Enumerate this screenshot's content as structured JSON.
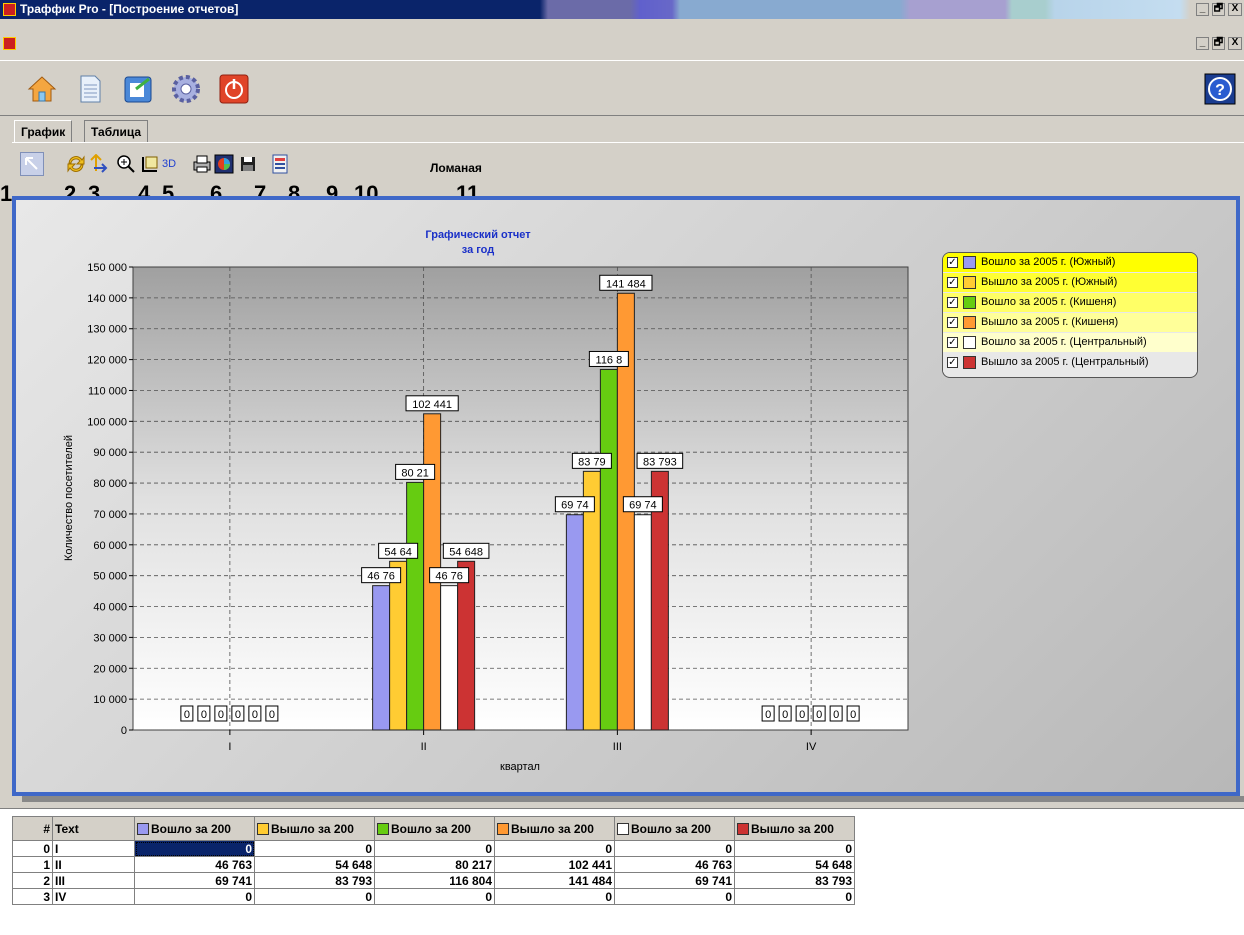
{
  "window": {
    "title": "Траффик Pro - [Построение отчетов]",
    "controls": [
      "_",
      "🗗",
      "X"
    ]
  },
  "toolbar_icons": [
    "home-icon",
    "report-icon",
    "export-icon",
    "settings-icon",
    "power-icon",
    "help-icon"
  ],
  "tabs": [
    {
      "label": "График",
      "active": true
    },
    {
      "label": "Таблица",
      "active": false
    }
  ],
  "chart_toolbar": {
    "icons": [
      "pointer-icon",
      "refresh-icon",
      "axes-icon",
      "zoom-icon",
      "frame-icon",
      "3d-icon",
      "print-icon",
      "palette-icon",
      "save-icon",
      "options-icon"
    ],
    "three_d_label": "3D",
    "chart_type": "Ломаная"
  },
  "annotation_numbers": [
    "1",
    "2",
    "3",
    "4",
    "5",
    "6",
    "7",
    "8",
    "9",
    "10",
    "11"
  ],
  "chart_data": {
    "type": "bar",
    "title": "Графический отчет",
    "subtitle": "за год",
    "xlabel": "квартал",
    "ylabel": "Количество посетителей",
    "ylim": [
      0,
      150000
    ],
    "yticks": [
      "0",
      "10 000",
      "20 000",
      "30 000",
      "40 000",
      "50 000",
      "60 000",
      "70 000",
      "80 000",
      "90 000",
      "100 000",
      "110 000",
      "120 000",
      "130 000",
      "140 000",
      "150 000"
    ],
    "categories": [
      "I",
      "II",
      "III",
      "IV"
    ],
    "grid": true,
    "legend_position": "top-right",
    "series": [
      {
        "name": "Вошло за 2005 г. (Южный)",
        "color": "#9999f0",
        "values": [
          0,
          46763,
          69741,
          0
        ],
        "labels": [
          "0",
          "46 76",
          "69 74",
          "0"
        ]
      },
      {
        "name": "Вышло за 2005 г. (Южный)",
        "color": "#ffcc33",
        "values": [
          0,
          54648,
          83793,
          0
        ],
        "labels": [
          "0",
          "54 64",
          "83 79",
          "0"
        ]
      },
      {
        "name": "Вошло за 2005 г. (Кишеня)",
        "color": "#66cc11",
        "values": [
          0,
          80217,
          116804,
          0
        ],
        "labels": [
          "0",
          "80 21",
          "116 8",
          "0"
        ]
      },
      {
        "name": "Вышло за 2005 г. (Кишеня)",
        "color": "#ff9933",
        "values": [
          0,
          102441,
          141484,
          0
        ],
        "labels": [
          "0",
          "102 441",
          "141 484",
          "0"
        ]
      },
      {
        "name": "Вошло за 2005 г. (Центральный)",
        "color": "#ffffff",
        "values": [
          0,
          46763,
          69741,
          0
        ],
        "labels": [
          "0",
          "46 76",
          "69 74",
          "0"
        ]
      },
      {
        "name": "Вышло за 2005 г. (Центральный)",
        "color": "#cc3333",
        "values": [
          0,
          54648,
          83793,
          0
        ],
        "labels": [
          "0",
          "54 648",
          "83 793",
          "0"
        ]
      }
    ]
  },
  "grid": {
    "headers": [
      "#",
      "Text",
      "Вошло за 200",
      "Вышло за 200",
      "Вошло за 200",
      "Вышло за 200",
      "Вошло за 200",
      "Вышло за 200"
    ],
    "header_colors": [
      "#9999f0",
      "#ffcc33",
      "#66cc11",
      "#ff9933",
      "#ffffff",
      "#cc3333"
    ],
    "rows": [
      [
        "0",
        "I",
        "0",
        "0",
        "0",
        "0",
        "0",
        "0"
      ],
      [
        "1",
        "II",
        "46 763",
        "54 648",
        "80 217",
        "102 441",
        "46 763",
        "54 648"
      ],
      [
        "2",
        "III",
        "69 741",
        "83 793",
        "116 804",
        "141 484",
        "69 741",
        "83 793"
      ],
      [
        "3",
        "IV",
        "0",
        "0",
        "0",
        "0",
        "0",
        "0"
      ]
    ]
  }
}
